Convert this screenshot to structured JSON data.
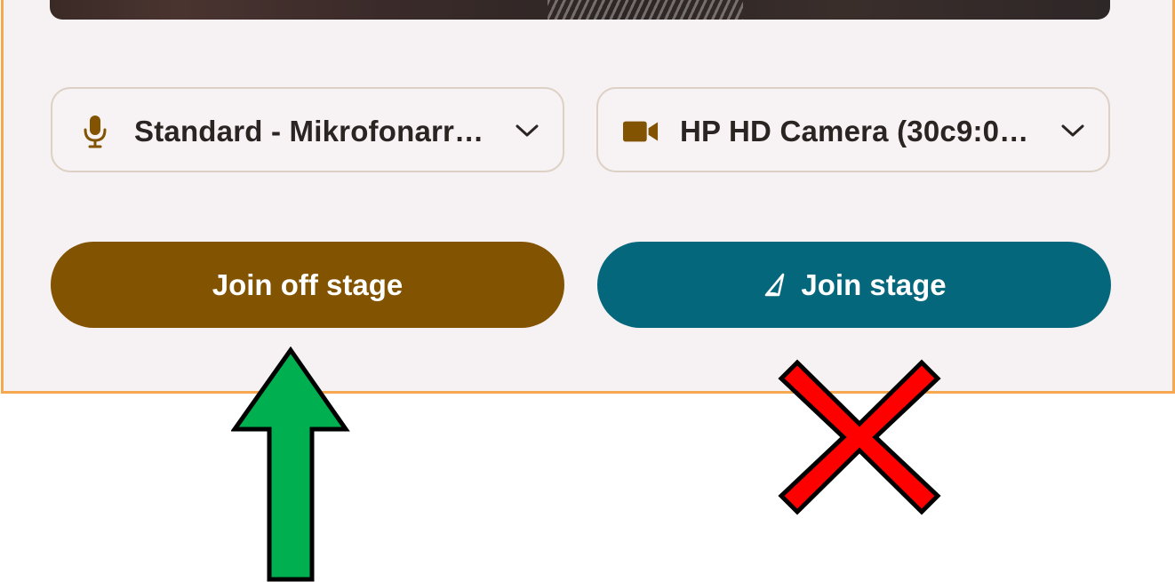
{
  "devices": {
    "microphone": {
      "icon": "microphone-icon",
      "selected": "Standard - Mikrofonarr…"
    },
    "camera": {
      "icon": "video-camera-icon",
      "selected": "HP HD Camera (30c9:0…"
    }
  },
  "actions": {
    "join_off_stage": "Join off stage",
    "join_stage": "Join stage",
    "join_stage_icon": "stage-spotlight-icon"
  },
  "colors": {
    "panel_border": "#f6a850",
    "panel_background": "#f6f1f2",
    "brown_accent": "#825300",
    "teal_accent": "#05677c",
    "annotation_arrow": "#00b050",
    "annotation_x": "#ff0000"
  },
  "annotations": {
    "arrow": "green-up-arrow-icon",
    "cross": "red-x-icon"
  }
}
